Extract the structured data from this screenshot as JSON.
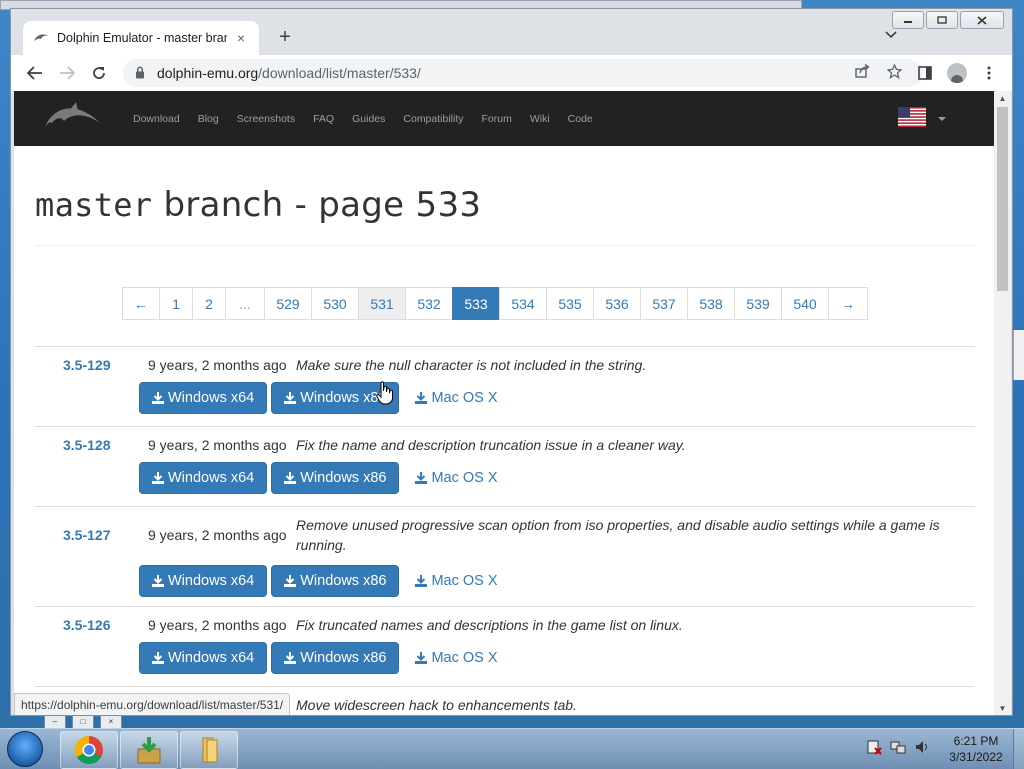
{
  "browser": {
    "tab_title": "Dolphin Emulator - master branc",
    "tab_close": "×",
    "new_tab": "+",
    "tab_list": "⌄",
    "url_host": "dolphin-emu.org",
    "url_path": "/download/list/master/533/",
    "status_url": "https://dolphin-emu.org/download/list/master/531/"
  },
  "site": {
    "nav": [
      "Download",
      "Blog",
      "Screenshots",
      "FAQ",
      "Guides",
      "Compatibility",
      "Forum",
      "Wiki",
      "Code"
    ],
    "title_mono": "master",
    "title_rest": " branch - page 533"
  },
  "pagination": {
    "items": [
      "←",
      "1",
      "2",
      "...",
      "529",
      "530",
      "531",
      "532",
      "533",
      "534",
      "535",
      "536",
      "537",
      "538",
      "539",
      "540",
      "→"
    ],
    "active": "533",
    "hover": "531"
  },
  "builds": [
    {
      "version": "3.5-129",
      "date": "9 years, 2 months ago",
      "message": "Make sure the null character is not included in the string."
    },
    {
      "version": "3.5-128",
      "date": "9 years, 2 months ago",
      "message": "Fix the name and description truncation issue in a cleaner way."
    },
    {
      "version": "3.5-127",
      "date": "9 years, 2 months ago",
      "message": "Remove unused progressive scan option from iso properties, and disable audio settings while a game is running."
    },
    {
      "version": "3.5-126",
      "date": "9 years, 2 months ago",
      "message": "Fix truncated names and descriptions in the game list on linux."
    },
    {
      "version": "",
      "date": "",
      "message": "Move widescreen hack to enhancements tab."
    }
  ],
  "download_labels": {
    "win64": "Windows x64",
    "win86": "Windows x86",
    "mac": "Mac OS X"
  },
  "taskbar": {
    "time": "6:21 PM",
    "date": "3/31/2022"
  },
  "colors": {
    "link": "#337ab7",
    "navbar": "#222222",
    "accent": "#337ab7"
  },
  "icons": [
    "dolphin-logo-icon",
    "us-flag-icon",
    "download-icon",
    "lock-icon",
    "chrome-icon",
    "installer-icon",
    "folder-icon",
    "windows-start-icon"
  ]
}
